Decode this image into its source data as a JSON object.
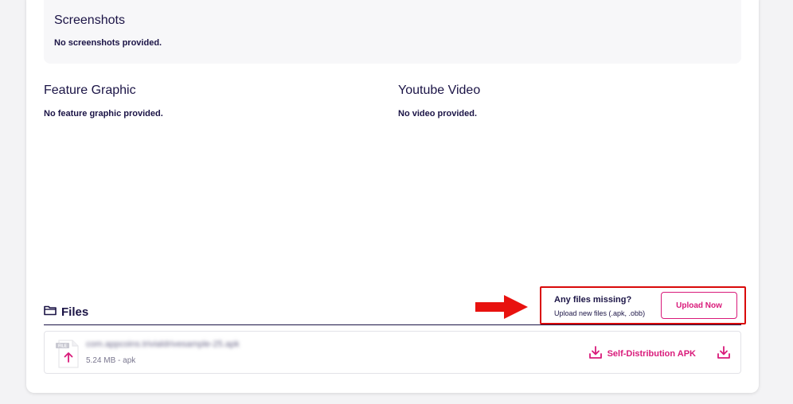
{
  "screenshots": {
    "title": "Screenshots",
    "empty_text": "No screenshots provided."
  },
  "feature_graphic": {
    "title": "Feature Graphic",
    "empty_text": "No feature graphic provided."
  },
  "youtube_video": {
    "title": "Youtube Video",
    "empty_text": "No video provided."
  },
  "files": {
    "title": "Files",
    "icon": "folder-icon",
    "missing_title": "Any files missing?",
    "missing_subtitle": "Upload new files (.apk, .obb)",
    "upload_label": "Upload Now",
    "items": [
      {
        "name": "com.appcoins.trivialdrivesample-25.apk",
        "meta": "5.24 MB - apk",
        "badge": "FILE",
        "action_label": "Self-Distribution APK"
      }
    ]
  },
  "colors": {
    "text": "#1b1446",
    "accent": "#d91a7a",
    "highlight": "#d90a0a",
    "panel": "#f7f7f9"
  }
}
